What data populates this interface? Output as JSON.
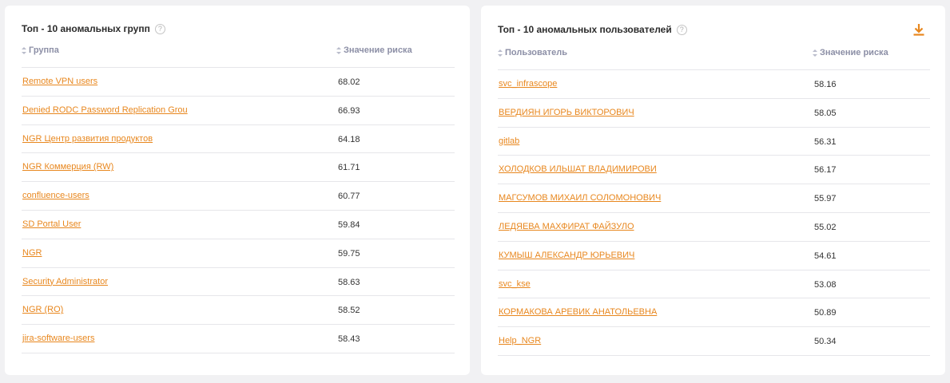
{
  "groups_card": {
    "title": "Топ - 10 аномальных групп",
    "help": "?",
    "col_name": "Группа",
    "col_value": "Значение риска",
    "rows": [
      {
        "name": "Remote VPN users",
        "value": "68.02"
      },
      {
        "name": "Denied RODC Password Replication Grou",
        "value": "66.93"
      },
      {
        "name": "NGR Центр развития продуктов",
        "value": "64.18"
      },
      {
        "name": "NGR Коммерция (RW)",
        "value": "61.71"
      },
      {
        "name": "confluence-users",
        "value": "60.77"
      },
      {
        "name": "SD Portal User",
        "value": "59.84"
      },
      {
        "name": "NGR",
        "value": "59.75"
      },
      {
        "name": "Security Administrator",
        "value": "58.63"
      },
      {
        "name": "NGR (RO)",
        "value": "58.52"
      },
      {
        "name": "jira-software-users",
        "value": "58.43"
      }
    ]
  },
  "users_card": {
    "title": "Топ - 10 аномальных пользователей",
    "help": "?",
    "col_name": "Пользователь",
    "col_value": "Значение риска",
    "download_icon": "download-icon",
    "rows": [
      {
        "name": "svc_infrascope",
        "value": "58.16"
      },
      {
        "name": "ВЕРДИЯН ИГОРЬ ВИКТОРОВИЧ",
        "value": "58.05"
      },
      {
        "name": "gitlab",
        "value": "56.31"
      },
      {
        "name": "ХОЛОДКОВ ИЛЬШАТ ВЛАДИМИРОВИ",
        "value": "56.17"
      },
      {
        "name": "МАГСУМОВ МИХАИЛ СОЛОМОНОВИЧ",
        "value": "55.97"
      },
      {
        "name": "ЛЕДЯЕВА МАХФИРАТ ФАЙЗУЛО",
        "value": "55.02"
      },
      {
        "name": "КУМЫШ АЛЕКСАНДР ЮРЬЕВИЧ",
        "value": "54.61"
      },
      {
        "name": "svc_kse",
        "value": "53.08"
      },
      {
        "name": "КОРМАКОВА АРЕВИК АНАТОЛЬЕВНА",
        "value": "50.89"
      },
      {
        "name": "Help_NGR",
        "value": "50.34"
      }
    ]
  },
  "colors": {
    "accent": "#e8871e",
    "header_text": "#8c8fa6",
    "background": "#f1f1f3"
  }
}
